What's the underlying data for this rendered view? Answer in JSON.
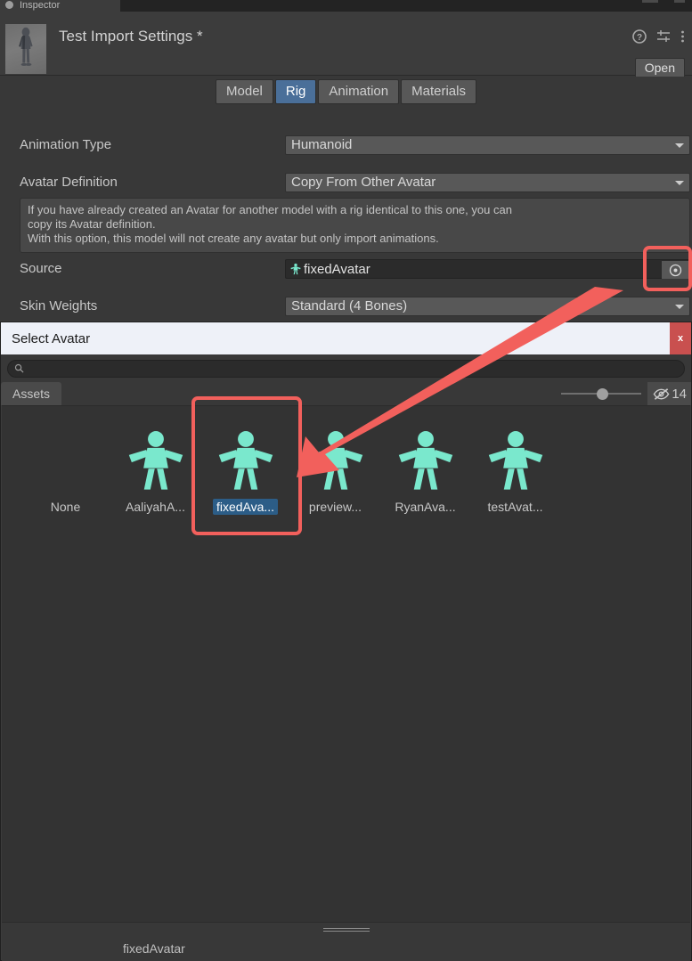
{
  "window": {
    "tab_label": "Inspector"
  },
  "inspector": {
    "title": "Test Import Settings *",
    "thumbnail_name": "humanoid-model-thumbnail",
    "open_label": "Open",
    "icons": [
      "help-icon",
      "preset-settings-icon",
      "more-menu-icon"
    ]
  },
  "tabs": [
    {
      "label": "Model",
      "active": false
    },
    {
      "label": "Rig",
      "active": true
    },
    {
      "label": "Animation",
      "active": false
    },
    {
      "label": "Materials",
      "active": false
    }
  ],
  "properties": {
    "animation_type": {
      "label": "Animation Type",
      "value": "Humanoid"
    },
    "avatar_definition": {
      "label": "Avatar Definition",
      "value": "Copy From Other Avatar"
    },
    "info_line_1": "If you have already created an Avatar for another model with a rig identical to this one, you can",
    "info_line_2": "copy its Avatar definition.",
    "info_line_3": "With this option, this model will not create any avatar but only import animations.",
    "source": {
      "label": "Source",
      "value": "fixedAvatar",
      "icon": "avatar-icon",
      "picker_icon": "object-picker-icon"
    },
    "skin_weights": {
      "label": "Skin Weights",
      "value": "Standard (4 Bones)"
    }
  },
  "modal": {
    "title": "Select Avatar",
    "close_label": "x",
    "search": {
      "value": "",
      "placeholder": "",
      "icon": "search-icon"
    },
    "tab": "Assets",
    "zoom_slider_value": 45,
    "visibility": {
      "icon": "eye-slash-icon",
      "count": "14"
    },
    "grid": [
      {
        "label": "None",
        "has_icon": false,
        "selected": false
      },
      {
        "label": "AaliyahA...",
        "has_icon": true,
        "selected": false
      },
      {
        "label": "fixedAva...",
        "has_icon": true,
        "selected": true
      },
      {
        "label": "preview...",
        "has_icon": true,
        "selected": false
      },
      {
        "label": "RyanAva...",
        "has_icon": true,
        "selected": false
      },
      {
        "label": "testAvat...",
        "has_icon": true,
        "selected": false
      }
    ],
    "footer_name": "fixedAvatar"
  },
  "colors": {
    "annotation": "#f2605c",
    "accent_selected": "#4a6f99",
    "avatar_icon": "#7ae8cd",
    "panel": "#383838",
    "panel_light": "#585858",
    "modal_titlebar": "#eef1f8",
    "close_red": "#c9504f"
  },
  "annotations": [
    {
      "name": "source-picker-highlight",
      "shape": "rounded-rect"
    },
    {
      "name": "fixed-avatar-cell-highlight",
      "shape": "rounded-rect"
    },
    {
      "name": "picker-to-cell-arrow",
      "shape": "arrow"
    }
  ]
}
